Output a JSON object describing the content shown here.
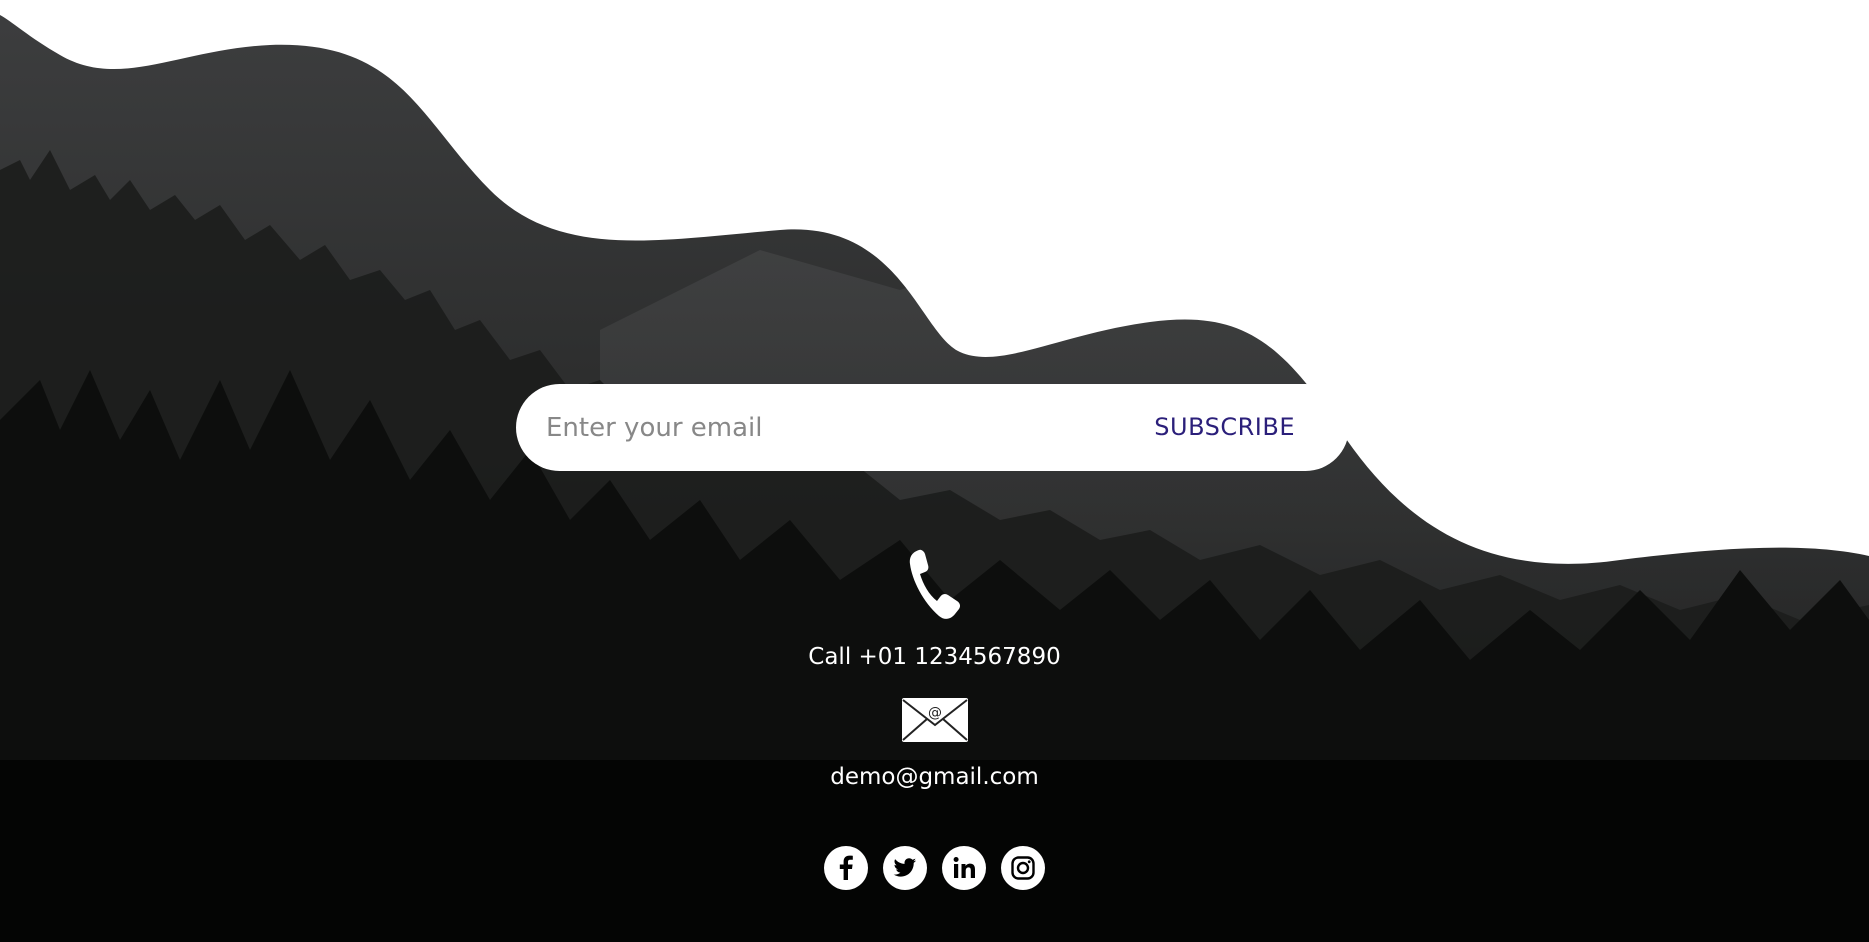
{
  "subscribe": {
    "placeholder": "Enter your email",
    "button_label": "SUBSCRIBE"
  },
  "contact": {
    "phone_icon": "phone-icon",
    "phone_text": "Call +01 1234567890",
    "email_icon": "envelope-icon",
    "email_text": "demo@gmail.com"
  },
  "social": {
    "icons": [
      "facebook-icon",
      "twitter-icon",
      "linkedin-icon",
      "instagram-icon"
    ]
  },
  "colors": {
    "accent": "#2b1f7a",
    "background_dark": "#1a1b1b",
    "wave_white": "#ffffff"
  }
}
